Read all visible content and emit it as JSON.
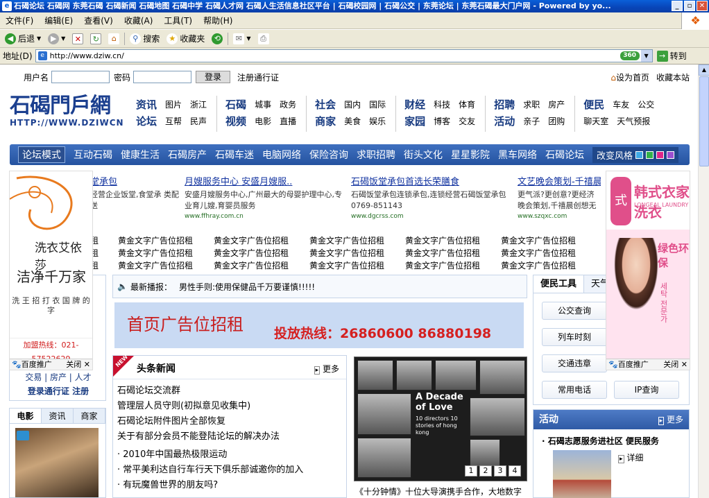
{
  "window": {
    "title": "石碣论坛 石碣网 东莞石碣 石碣新闻 石碣地图 石碣中学 石碣人才网 石碣人生活信息社区平台 | 石碣校园网 | 石碣公交 | 东莞论坛 | 东莞石碣最大门户网 - Powered by yo..."
  },
  "menu": [
    "文件(F)",
    "编辑(E)",
    "查看(V)",
    "收藏(A)",
    "工具(T)",
    "帮助(H)"
  ],
  "toolbar": {
    "back": "后退",
    "search": "搜索",
    "favorites": "收藏夹"
  },
  "address": {
    "label": "地址(D)",
    "url": "http://www.dziw.cn/",
    "go": "转到",
    "badge": "360"
  },
  "login": {
    "username_label": "用户名",
    "password_label": "密码",
    "login_btn": "登录",
    "register": "注册通行证",
    "set_home": "设为首页",
    "bookmark": "收藏本站"
  },
  "logo": {
    "cn": "石碣門戶網",
    "en": "HTTP://WWW.DZIWCN"
  },
  "nav": [
    {
      "rows": [
        [
          "资讯",
          "图片",
          "浙江"
        ],
        [
          "论坛",
          "互帮",
          "民声"
        ]
      ]
    },
    {
      "rows": [
        [
          "石碣",
          "城事",
          "政务"
        ],
        [
          "视频",
          "电影",
          "直播"
        ]
      ]
    },
    {
      "rows": [
        [
          "社会",
          "国内",
          "国际"
        ],
        [
          "商家",
          "美食",
          "娱乐"
        ]
      ]
    },
    {
      "rows": [
        [
          "财经",
          "科技",
          "体育"
        ],
        [
          "家园",
          "博客",
          "交友"
        ]
      ]
    },
    {
      "rows": [
        [
          "招聘",
          "求职",
          "房产"
        ],
        [
          "活动",
          "亲子",
          "团购"
        ]
      ]
    },
    {
      "rows": [
        [
          "便民",
          "车友",
          "公交"
        ],
        [
          "聊天室",
          "天气预报"
        ]
      ]
    }
  ],
  "bluebar": {
    "first": "论坛模式",
    "items": [
      "互动石碣",
      "健康生活",
      "石碣房产",
      "石碣车迷",
      "电脑网络",
      "保险咨询",
      "求职招聘",
      "街头文化",
      "星星影院",
      "黑车网络",
      "石碣论坛"
    ],
    "style_label": "改变风格",
    "swatches": [
      "#3fa9e6",
      "#33b24a",
      "#e0268a",
      "#9b4fd0"
    ]
  },
  "featured": [
    {
      "title": "堂承包",
      "desc": "经营企业饭堂,食堂承 类配送",
      "url": ""
    },
    {
      "title": "月嫂服务中心 安盛月嫂服..",
      "desc": "安盛月嫂服务中心,广州最大的母婴护理中心,专业育儿嫂,育婴员服务",
      "url": "www.ffhray.com.cn"
    },
    {
      "title": "石碣饭堂承包首选长荣膳食",
      "desc": "石碣饭堂承包连锁承包,连锁经营石碣饭堂承包0769-851143",
      "url": "www.dgcrss.com"
    },
    {
      "title": "文艺晚会策划-千禧晨",
      "desc": "更气派?更创意?更经济 晚会策划,千禧晨创想无",
      "url": "www.szqxc.com"
    }
  ],
  "ad_rows": [
    [
      "租",
      "黄金文字广告位招租",
      "黄金文字广告位招租",
      "黄金文字广告位招租",
      "黄金文字广告位招租",
      "黄金文字广告位招租"
    ],
    [
      "租",
      "黄金文字广告位招租",
      "黄金文字广告位招租",
      "黄金文字广告位招租",
      "黄金文字广告位招租",
      "黄金文字广告位招租"
    ],
    [
      "租",
      "黄金文字广告位招租",
      "黄金文字广告位招租",
      "黄金文字广告位招租",
      "黄金文字广告位招租",
      "黄金文字广告位招租"
    ]
  ],
  "left_ad": {
    "t1": "洗衣艾依莎",
    "t2": "洁净千万家",
    "t3": "洗 王 招 打 衣 国 牌 的 字",
    "t4": "加盟热线：021-57522629",
    "baidu": "百度推广",
    "close": "关闭"
  },
  "left_box": {
    "links": "交易 | 房产 | 人才",
    "register": "登录通行证 注册"
  },
  "tabs3": [
    "电影",
    "资讯",
    "商家"
  ],
  "notice": {
    "label": "最新播报：",
    "text": "男性手则:使用保健品千万要谨慎!!!!!"
  },
  "banner": {
    "a": "首页广告位招租",
    "b": "投放热线：26860600  86880198"
  },
  "news": {
    "title": "头条新闻",
    "more": "更多",
    "new_tag": "NEW",
    "headlines": [
      "石碣论坛交流群",
      "管理层人员守则(初拟意见收集中)",
      "石碣论坛附件图片全部恢复",
      "关于有部分会员不能登陆论坛的解决办法"
    ],
    "subs": [
      "· 2010年中国最热极限运动",
      "· 常平美利达自行车行天下俱乐部诚邀你的加入",
      "· 有玩魔兽世界的朋友吗?"
    ]
  },
  "photo": {
    "title": "A Decade of Love",
    "sub": "10 directors 10 stories of hong kong",
    "pages": [
      "1",
      "2",
      "3",
      "4"
    ],
    "caption": "《十分钟情》十位大导演携手合作，大地数字"
  },
  "right_ad": {
    "brand": "韩式衣家洗衣",
    "sub": "LONGEAL LAUNDRY",
    "slogan": "绿色环保",
    "ko": "세탁 전문가",
    "baidu": "百度推广",
    "close": "关闭"
  },
  "tools": {
    "tab1": "便民工具",
    "tab2": "天气",
    "buttons": [
      "公交查询",
      "列车时刻",
      "交通违章",
      "常用电话",
      "IP查询"
    ]
  },
  "activity": {
    "title": "活动",
    "more": "更多",
    "item": "石碣志愿服务进社区 便民服务",
    "detail": "详细"
  }
}
